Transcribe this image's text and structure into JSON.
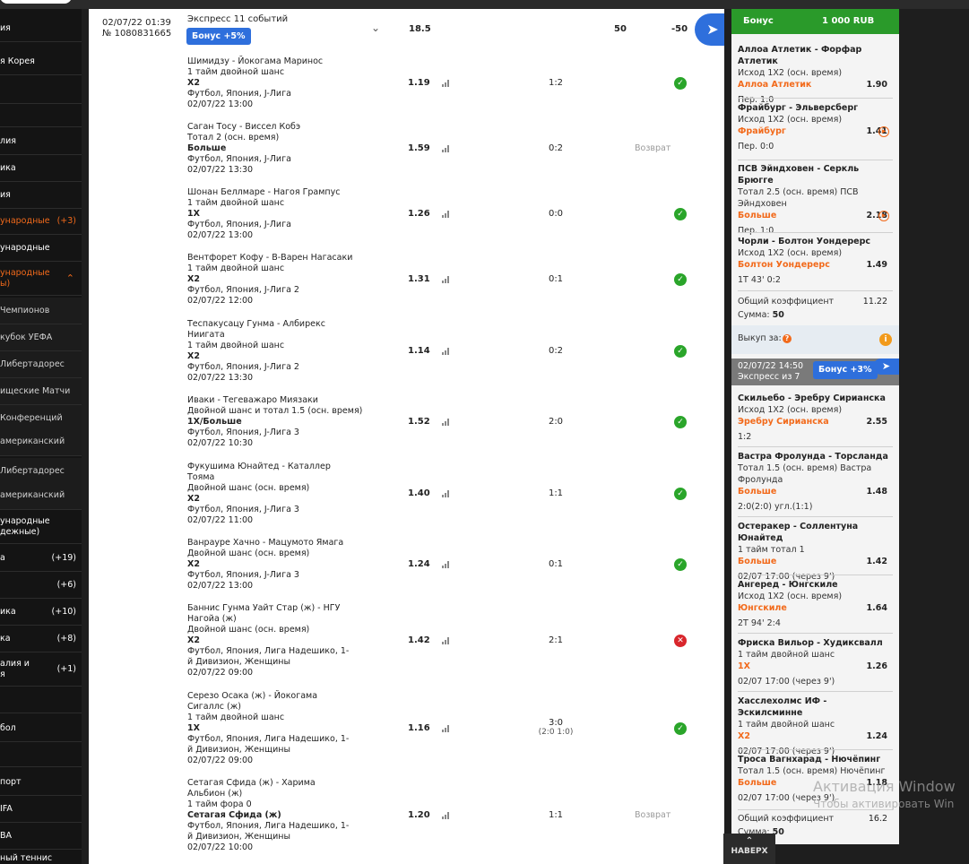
{
  "sidebar": {
    "items": [
      {
        "label": "ия",
        "count": "",
        "style": "normal"
      },
      {
        "label": "я Корея",
        "count": "",
        "style": "normal"
      },
      {
        "label": "",
        "count": "",
        "style": "normal"
      },
      {
        "label": "",
        "count": "",
        "style": "normal"
      },
      {
        "label": "лия",
        "count": "",
        "style": "normal"
      },
      {
        "label": "ика",
        "count": "",
        "style": "normal"
      },
      {
        "label": "ия",
        "count": "",
        "style": "normal"
      },
      {
        "label": "ународные",
        "count": "(+3)",
        "style": "orange"
      },
      {
        "label": "ународные",
        "count": "",
        "style": "normal"
      },
      {
        "label": "ународные\nы)",
        "count": "",
        "style": "orange-expanded"
      },
      {
        "label": "Чемпионов",
        "count": "",
        "style": "sub"
      },
      {
        "label": "кубок УЕФА",
        "count": "",
        "style": "sub"
      },
      {
        "label": " Либертадорес",
        "count": "",
        "style": "sub"
      },
      {
        "label": "ищеские Матчи",
        "count": "",
        "style": "sub"
      },
      {
        "label": "Конференций",
        "count": "",
        "style": "sub"
      },
      {
        "label": "американский",
        "count": "",
        "style": "sub"
      },
      {
        "label": " Либертадорес",
        "count": "",
        "style": "sub"
      },
      {
        "label": "американский",
        "count": "",
        "style": "sub"
      },
      {
        "label": "ународные\nдежные)",
        "count": "",
        "style": "normal"
      },
      {
        "label": "а",
        "count": "(+19)",
        "style": "normal"
      },
      {
        "label": "",
        "count": "(+6)",
        "style": "normal"
      },
      {
        "label": "ика",
        "count": "(+10)",
        "style": "normal"
      },
      {
        "label": "ка",
        "count": "(+8)",
        "style": "normal"
      },
      {
        "label": "алия и\nя",
        "count": "(+1)",
        "style": "normal"
      },
      {
        "label": "",
        "count": "",
        "style": "normal"
      },
      {
        "label": "бол",
        "count": "",
        "style": "normal"
      },
      {
        "label": "",
        "count": "",
        "style": "normal"
      },
      {
        "label": "порт",
        "count": "",
        "style": "normal"
      },
      {
        "label": "IFA",
        "count": "",
        "style": "normal"
      },
      {
        "label": "BA",
        "count": "",
        "style": "normal"
      },
      {
        "label": "ный теннис",
        "count": "",
        "style": "normal"
      }
    ]
  },
  "bet": {
    "datetime": "02/07/22 01:39",
    "number": "№ 1080831665",
    "title": "Экспресс 11 событий",
    "bonus": "Бонус +5%",
    "total_odd": "18.5",
    "stake": "50",
    "result": "-50"
  },
  "events": [
    {
      "match": "Шимидзу - Йокогама Маринос",
      "market": "1 тайм двойной шанс",
      "pick": "X2",
      "league": "Футбол, Япония, J-Лига",
      "date": "02/07/22 13:00",
      "odd": "1.19",
      "score": "1:2",
      "score_sub": "",
      "status": "win",
      "status_text": ""
    },
    {
      "match": "Саган Тосу - Виссел Кобэ",
      "market": "Тотал 2 (осн. время)",
      "pick": "Больше",
      "league": "Футбол, Япония, J-Лига",
      "date": "02/07/22 13:30",
      "odd": "1.59",
      "score": "0:2",
      "score_sub": "",
      "status": "refund",
      "status_text": "Возврат"
    },
    {
      "match": "Шонан Беллмаре - Нагоя Грампус",
      "market": "1 тайм двойной шанс",
      "pick": "1X",
      "league": "Футбол, Япония, J-Лига",
      "date": "02/07/22 13:00",
      "odd": "1.26",
      "score": "0:0",
      "score_sub": "",
      "status": "win",
      "status_text": ""
    },
    {
      "match": "Вентфорет Кофу - В-Варен Нагасаки",
      "market": "1 тайм двойной шанс",
      "pick": "X2",
      "league": "Футбол, Япония, J-Лига 2",
      "date": "02/07/22 12:00",
      "odd": "1.31",
      "score": "0:1",
      "score_sub": "",
      "status": "win",
      "status_text": ""
    },
    {
      "match": "Теспакусацу Гунма - Албирекс\nНиигата",
      "market": "1 тайм двойной шанс",
      "pick": "X2",
      "league": "Футбол, Япония, J-Лига 2",
      "date": "02/07/22 13:30",
      "odd": "1.14",
      "score": "0:2",
      "score_sub": "",
      "status": "win",
      "status_text": ""
    },
    {
      "match": "Иваки - Тегеважаро Миязаки",
      "market": "Двойной шанс и тотал 1.5 (осн. время)",
      "pick": "1X/Больше",
      "league": "Футбол, Япония, J-Лига 3",
      "date": "02/07/22 10:30",
      "odd": "1.52",
      "score": "2:0",
      "score_sub": "",
      "status": "win",
      "status_text": ""
    },
    {
      "match": "Фукушима Юнайтед - Каталлер\nТояма",
      "market": "Двойной шанс (осн. время)",
      "pick": "X2",
      "league": "Футбол, Япония, J-Лига 3",
      "date": "02/07/22 11:00",
      "odd": "1.40",
      "score": "1:1",
      "score_sub": "",
      "status": "win",
      "status_text": ""
    },
    {
      "match": "Ванрауре Хачно - Мацумото Ямага",
      "market": "Двойной шанс (осн. время)",
      "pick": "X2",
      "league": "Футбол, Япония, J-Лига 3",
      "date": "02/07/22 13:00",
      "odd": "1.24",
      "score": "0:1",
      "score_sub": "",
      "status": "win",
      "status_text": ""
    },
    {
      "match": "Баннис Гунма Уайт Стар (ж) - НГУ\nНагойа (ж)",
      "market": "Двойной шанс (осн. время)",
      "pick": "X2",
      "league": "Футбол, Япония, Лига Надешико, 1-\nй Дивизион, Женщины",
      "date": "02/07/22 09:00",
      "odd": "1.42",
      "score": "2:1",
      "score_sub": "",
      "status": "lose",
      "status_text": ""
    },
    {
      "match": "Серезо Осака (ж) - Йокогама\nСигаллс (ж)",
      "market": "1 тайм двойной шанс",
      "pick": "1X",
      "league": "Футбол, Япония, Лига Надешико, 1-\nй Дивизион, Женщины",
      "date": "02/07/22 09:00",
      "odd": "1.16",
      "score": "3:0",
      "score_sub": "(2:0 1:0)",
      "status": "win",
      "status_text": ""
    },
    {
      "match": "Сетагая Сфида (ж) - Харима\nАльбион (ж)",
      "market": "1 тайм фора 0",
      "pick": "Сетагая Сфида (ж)",
      "league": "Футбол, Япония, Лига Надешико, 1-\nй Дивизион, Женщины",
      "date": "02/07/22 10:00",
      "odd": "1.20",
      "score": "1:1",
      "score_sub": "",
      "status": "refund",
      "status_text": "Возврат"
    }
  ],
  "right": {
    "bonus_label": "Бонус",
    "bonus_amount": "1 000 RUB",
    "slip1": [
      {
        "match": "Аллоа Атлетик - Форфар Атлетик",
        "market": "Исход 1X2 (осн. время)",
        "pick": "Аллоа Атлетик",
        "odd": "1.90",
        "state": "Пер. 1:0",
        "live": false
      },
      {
        "match": "Фрайбург - Эльверсберг",
        "market": "Исход 1X2 (осн. время)",
        "pick": "Фрайбург",
        "odd": "1.41",
        "state": "Пер. 0:0",
        "live": true
      },
      {
        "match": "ПСВ Эйндховен - Серкль Брюгге",
        "market": "Тотал 2.5 (осн. время) ПСВ\nЭйндховен",
        "pick": "Больше",
        "odd": "2.18",
        "state": "Пер. 1:0",
        "live": true
      },
      {
        "match": "Чорли - Болтон Уондерерс",
        "market": "Исход 1X2 (осн. время)",
        "pick": "Болтон Уондерерс",
        "odd": "1.49",
        "state": "1Т 43' 0:2",
        "live": false
      }
    ],
    "total_label": "Общий коэффициент",
    "total_odd1": "11.22",
    "sum_label": "Сумма:",
    "sum_value": "50",
    "cashout_label": "Выкуп за:",
    "cashout_icon": "?",
    "info_icon": "i",
    "slip2_datetime": "02/07/22 14:50",
    "slip2_title": "Экспресс из 7",
    "slip2_bonus": "Бонус +3%",
    "slip2": [
      {
        "match": "Скильебо - Эребру Сирианска",
        "market": "Исход 1X2 (осн. время)",
        "pick": "Эребру Сирианска",
        "odd": "2.55",
        "state": "1:2"
      },
      {
        "match": "Вастра Фролунда - Торсланда",
        "market": "Тотал 1.5 (осн. время) Вастра\nФролунда",
        "pick": "Больше",
        "odd": "1.48",
        "state": "2:0(2:0) угл.(1:1)"
      },
      {
        "match": "Остеракер - Соллентуна Юнайтед",
        "market": "1 тайм тотал 1",
        "pick": "Больше",
        "odd": "1.42",
        "state": "02/07 17:00 (через 9')"
      },
      {
        "match": "Ангеред - Юнгскиле",
        "market": "Исход 1X2 (осн. время)",
        "pick": "Юнгскиле",
        "odd": "1.64",
        "state": "2Т 94' 2:4"
      },
      {
        "match": "Фриска Вильор - Худиксвалл",
        "market": "1 тайм двойной шанс",
        "pick": "1X",
        "odd": "1.26",
        "state": "02/07 17:00 (через 9')"
      },
      {
        "match": "Хасслехолмс ИФ - Эскилсминне",
        "market": "1 тайм двойной шанс",
        "pick": "X2",
        "odd": "1.24",
        "state": "02/07 17:00 (через 9')"
      },
      {
        "match": "Троса Вагнхарад - Нючёпинг",
        "market": "Тотал 1.5 (осн. время) Нючёпинг",
        "pick": "Больше",
        "odd": "1.18",
        "state": "02/07 17:00 (через 9')"
      }
    ],
    "total_odd2": "16.2",
    "sum_value2": "50"
  },
  "totop_label": "НАВЕРХ",
  "watermark": {
    "line1": "Активация Window",
    "line2": "Чтобы активировать Win"
  },
  "colors": {
    "accent": "#f26a1b",
    "blue": "#2e6fdc",
    "green": "#2a9a2a",
    "win": "#2aa52a",
    "lose": "#d9262c"
  }
}
